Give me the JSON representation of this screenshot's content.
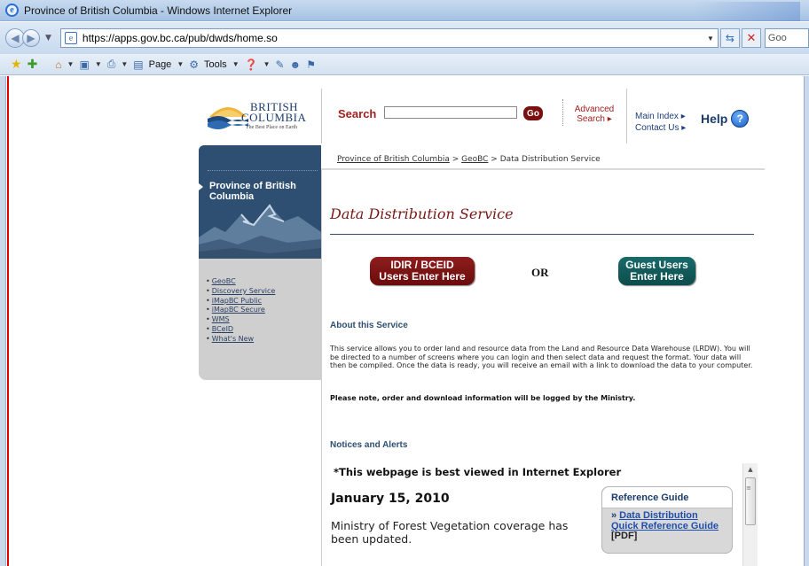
{
  "window": {
    "title": "Province of British Columbia - Windows Internet Explorer"
  },
  "addressbar": {
    "url": "https://apps.gov.bc.ca/pub/dwds/home.so",
    "search_stub": "Goo"
  },
  "commandbar": {
    "page_label": "Page",
    "tools_label": "Tools"
  },
  "header": {
    "logo": {
      "line1": "BRITISH",
      "line2": "COLUMBIA",
      "tagline": "The Best Place on Earth"
    },
    "search_label": "Search",
    "search_value": "",
    "go_label": "Go",
    "advanced_search_line1": "Advanced",
    "advanced_search_line2": "Search ▸",
    "main_index": "Main Index ▸",
    "contact_us": "Contact Us ▸",
    "help_label": "Help"
  },
  "breadcrumb": {
    "items": [
      "Province of British Columbia",
      "GeoBC",
      "Data Distribution Service"
    ],
    "separator": " > "
  },
  "sidebar": {
    "title": "Province of British Columbia",
    "links": [
      "GeoBC",
      "Discovery Service",
      "iMapBC Public",
      "iMapBC Secure",
      "WMS",
      "BCeID",
      "What's New"
    ]
  },
  "main": {
    "page_title": "Data Distribution Service",
    "idir_button_line1": "IDIR / BCEID",
    "idir_button_line2": "Users Enter Here",
    "or_text": "OR",
    "guest_button_line1": "Guest Users",
    "guest_button_line2": "Enter Here",
    "about_heading": "About this Service",
    "about_text": "This service allows you to order land and resource data from the Land and Resource Data Warehouse (LRDW). You will be directed to a number of screens where you can login and then select data and request the format. Your data will then be compiled. Once the data is ready, you will receive an email with a link to download the data to your computer.",
    "note_text": "Please note, order and download information will be logged by the Ministry.",
    "notices_heading": "Notices and Alerts"
  },
  "notices": {
    "best_viewed": "*This webpage is best viewed in Internet Explorer",
    "date": "January 15, 2010",
    "body": "Ministry of Forest Vegetation coverage has been updated."
  },
  "reference_guide": {
    "heading": "Reference Guide",
    "link_text": "Data Distribution Quick Reference Guide",
    "suffix": "[PDF]"
  },
  "colors": {
    "brand_dark_red": "#7a1717",
    "brand_navy": "#2e4f72",
    "guest_teal": "#0c4c4c"
  }
}
